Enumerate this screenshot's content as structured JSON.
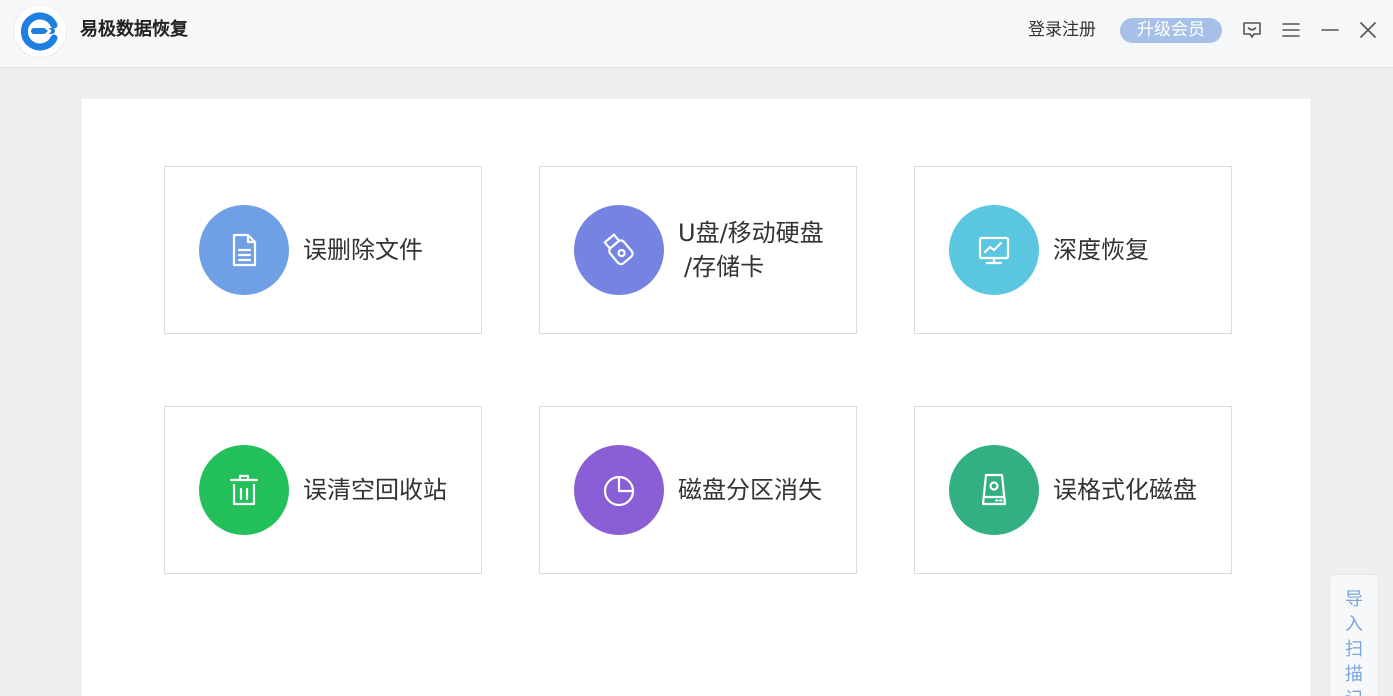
{
  "app": {
    "title": "易极数据恢复"
  },
  "header": {
    "login_label": "登录注册",
    "upgrade_label": "升级会员"
  },
  "colors": {
    "brand_blue": "#1e7fe0",
    "upgrade_bg": "#a7c0e7",
    "card1": "#6fa0e6",
    "card2": "#7584e1",
    "card3": "#5bc6e0",
    "card4": "#22bf5a",
    "card5": "#8a5fd5",
    "card6": "#33b082",
    "side_tab_text": "#7aa6dc"
  },
  "cards": [
    {
      "label": "误删除文件",
      "icon": "document-icon"
    },
    {
      "label_line1": "U盘/移动硬盘",
      "label_line2": "/存储卡",
      "icon": "usb-drive-icon"
    },
    {
      "label": "深度恢复",
      "icon": "monitor-chart-icon"
    },
    {
      "label": "误清空回收站",
      "icon": "trash-icon"
    },
    {
      "label": "磁盘分区消失",
      "icon": "pie-chart-icon"
    },
    {
      "label": "误格式化磁盘",
      "icon": "hard-disk-icon"
    }
  ],
  "side_tab": {
    "chars": [
      "导",
      "入",
      "扫",
      "描",
      "记"
    ]
  }
}
